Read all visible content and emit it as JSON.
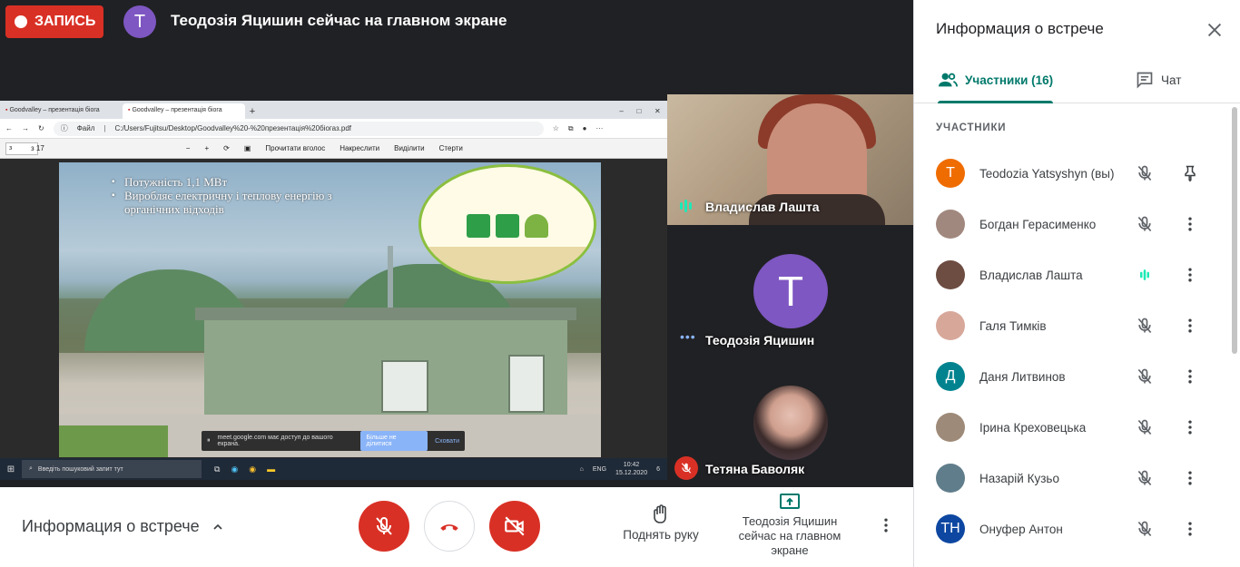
{
  "header": {
    "record_label": "ЗАПИСЬ",
    "presenter_initial": "T",
    "presenter_text": "Теодозія Яцишин сейчас на главном экране"
  },
  "shared_screen": {
    "tabs": [
      "Goodvalley – презентація біога",
      "Goodvalley – презентація біога"
    ],
    "url_label": "Файл",
    "url": "C:/Users/Fujitsu/Desktop/Goodvalley%20-%20презентація%20біогаз.pdf",
    "page_field": "з",
    "page_of": "з 17",
    "pdf_tools": [
      "Прочитати вголос",
      "Накреслити",
      "Виділити",
      "Стерти"
    ],
    "slide_bullets": [
      "Потужність 1,1 МВт",
      "Виробляє електричну і теплову енергію з органічних відходів"
    ],
    "share_notice": "meet.google.com має доступ до вашого екрана.",
    "share_stop": "Більше не ділитися",
    "share_hide": "Сховати",
    "taskbar_search": "Введіть пошуковий запит тут",
    "taskbar_lang": "ENG",
    "taskbar_time": "10:42",
    "taskbar_date": "15.12.2020",
    "taskbar_badge": "6"
  },
  "tiles": [
    {
      "name": "Владислав Лашта"
    },
    {
      "name": "Теодозія Яцишин",
      "initial": "T"
    },
    {
      "name": "Тетяна Баволяк"
    }
  ],
  "bottombar": {
    "meeting_info": "Информация о встрече",
    "raise_hand": "Поднять руку",
    "presenting": "Теодозія Яцишин сейчас на главном экране"
  },
  "panel": {
    "title": "Информация о встрече",
    "tab_people": "Участники (16)",
    "tab_chat": "Чат",
    "section_label": "УЧАСТНИКИ",
    "participants": [
      {
        "name": "Teodozia Yatsyshyn (вы)",
        "initial": "T",
        "color": "#ef6c00",
        "speaking": false
      },
      {
        "name": "Богдан Герасименко",
        "initial": "",
        "color": "#a1887f",
        "speaking": false
      },
      {
        "name": "Владислав Лашта",
        "initial": "",
        "color": "#6d4c41",
        "speaking": true
      },
      {
        "name": "Галя Тимків",
        "initial": "",
        "color": "#d7a89a",
        "speaking": false
      },
      {
        "name": "Даня Литвинов",
        "initial": "Д",
        "color": "#00838f",
        "speaking": false
      },
      {
        "name": "Ірина Креховецька",
        "initial": "",
        "color": "#9e8a78",
        "speaking": false
      },
      {
        "name": "Назарій Кузьо",
        "initial": "",
        "color": "#607d8b",
        "speaking": false
      },
      {
        "name": "Онуфер Антон",
        "initial": "TH",
        "color": "#0d47a1",
        "speaking": false
      }
    ]
  },
  "colors": {
    "record_red": "#d93025",
    "accent_teal": "#00796b",
    "speaking_green": "#1de9b6",
    "avatar_purple": "#7e57c2"
  }
}
